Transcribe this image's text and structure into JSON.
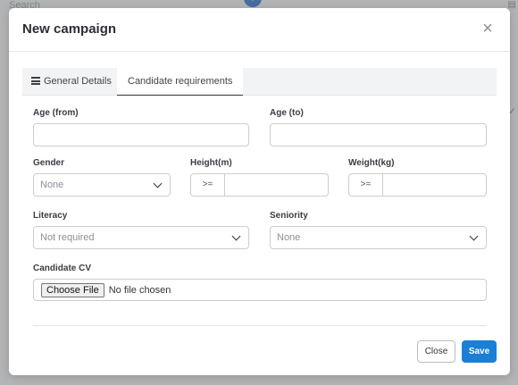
{
  "background": {
    "search_placeholder": "Search",
    "plus_icon": "+",
    "right_glyph": "✓",
    "top_right_glyph": "▤"
  },
  "modal": {
    "title": "New campaign",
    "close_icon": "×"
  },
  "tabs": [
    {
      "label": "General Details",
      "icon": "list-icon",
      "active": false
    },
    {
      "label": "Candidate requirements",
      "active": true
    }
  ],
  "form": {
    "age_from": {
      "label": "Age (from)",
      "value": ""
    },
    "age_to": {
      "label": "Age (to)",
      "value": ""
    },
    "gender": {
      "label": "Gender",
      "selected": "None"
    },
    "height": {
      "label": "Height(m)",
      "operator": ">=",
      "value": ""
    },
    "weight": {
      "label": "Weight(kg)",
      "operator": ">=",
      "value": ""
    },
    "literacy": {
      "label": "Literacy",
      "selected": "Not required"
    },
    "seniority": {
      "label": "Seniority",
      "selected": "None"
    },
    "candidate_cv": {
      "label": "Candidate CV",
      "button_label": "Choose File",
      "status": "No file chosen"
    }
  },
  "footer": {
    "close_label": "Close",
    "save_label": "Save"
  },
  "colors": {
    "primary": "#1a7fd6",
    "overlay": "#5a5a5a"
  }
}
